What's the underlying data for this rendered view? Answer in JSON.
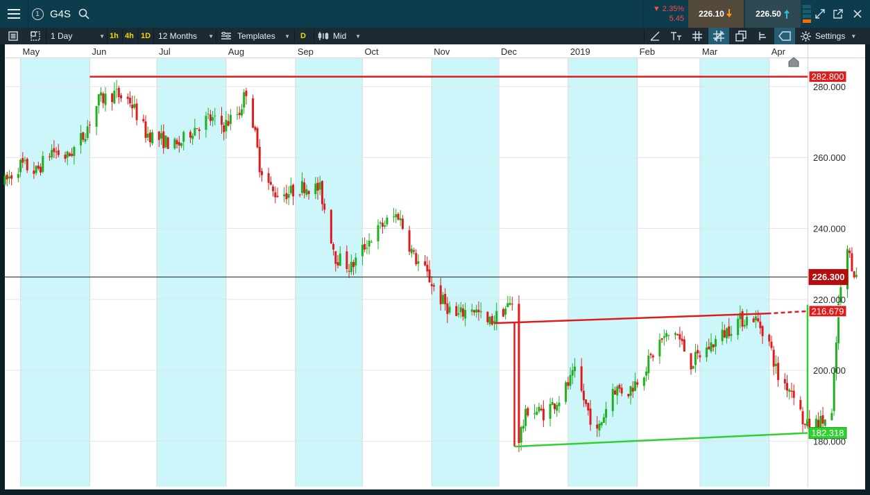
{
  "header": {
    "symbol": "G4S",
    "info_badge": "1",
    "change_pct": "▼ 2.35%",
    "change_abs": "5.45",
    "sell_price": "226.10",
    "buy_price": "226.50",
    "icons": [
      "menu-icon",
      "info-icon",
      "search-icon",
      "level-bars-icon",
      "expand-icon",
      "external-link-icon",
      "close-icon"
    ]
  },
  "toolbar": {
    "interval": "1 Day",
    "quick_intervals": [
      "1h",
      "4h",
      "1D"
    ],
    "range": "12 Months",
    "templates": "Templates",
    "d_badge": "D",
    "price_mode": "Mid",
    "settings": "Settings",
    "icons": [
      "list-icon",
      "layout-icon",
      "template-icon",
      "candles-icon",
      "draw-line-icon",
      "text-tool-icon",
      "grid-icon",
      "crosshair-icon",
      "copy-icon",
      "measure-icon",
      "tag-icon",
      "settings-gear-icon"
    ]
  },
  "colors": {
    "up": "#1fb01f",
    "down": "#e01b1b",
    "shade": "#cdf6fb",
    "resistance": "#e01b1b",
    "support": "#30d030",
    "last_price_bg": "#b40d0d"
  },
  "chart_data": {
    "type": "candlestick",
    "x_axis_labels": [
      "May",
      "Jun",
      "Jul",
      "Aug",
      "Sep",
      "Oct",
      "Nov",
      "Dec",
      "2019",
      "Feb",
      "Mar",
      "Apr"
    ],
    "x_axis_dates": [
      "2018-05-01",
      "2018-06-01",
      "2018-07-01",
      "2018-08-01",
      "2018-09-01",
      "2018-10-01",
      "2018-11-01",
      "2018-12-01",
      "2019-01-01",
      "2019-02-01",
      "2019-03-01",
      "2019-04-01"
    ],
    "y_tick_labels": [
      "180.000",
      "200.000",
      "220.000",
      "240.000",
      "260.000",
      "280.000"
    ],
    "ylim": [
      168.5,
      288.0
    ],
    "xlim": [
      "2018-04-24",
      "2019-04-23"
    ],
    "last_price": 226.3,
    "last_price_label": "226.300",
    "shaded_months": [
      "May",
      "Jul",
      "Sep",
      "Nov",
      "2019",
      "Mar"
    ],
    "price_path": [
      [
        "2018-04-24",
        253
      ],
      [
        "2018-05-01",
        258
      ],
      [
        "2018-05-08",
        256
      ],
      [
        "2018-05-15",
        262
      ],
      [
        "2018-05-22",
        260
      ],
      [
        "2018-05-29",
        266
      ],
      [
        "2018-06-05",
        276
      ],
      [
        "2018-06-12",
        278
      ],
      [
        "2018-06-19",
        276
      ],
      [
        "2018-06-26",
        267
      ],
      [
        "2018-07-03",
        265
      ],
      [
        "2018-07-10",
        263
      ],
      [
        "2018-07-17",
        268
      ],
      [
        "2018-07-24",
        271
      ],
      [
        "2018-07-31",
        269
      ],
      [
        "2018-08-07",
        273
      ],
      [
        "2018-08-10",
        279
      ],
      [
        "2018-08-13",
        270
      ],
      [
        "2018-08-16",
        258
      ],
      [
        "2018-08-22",
        250
      ],
      [
        "2018-08-29",
        250
      ],
      [
        "2018-09-05",
        252
      ],
      [
        "2018-09-12",
        251
      ],
      [
        "2018-09-19",
        232
      ],
      [
        "2018-09-26",
        229
      ],
      [
        "2018-10-03",
        236
      ],
      [
        "2018-10-10",
        241
      ],
      [
        "2018-10-17",
        244
      ],
      [
        "2018-10-24",
        232
      ],
      [
        "2018-10-29",
        228
      ],
      [
        "2018-11-05",
        220
      ],
      [
        "2018-11-12",
        215
      ],
      [
        "2018-11-19",
        218
      ],
      [
        "2018-11-26",
        213
      ],
      [
        "2018-12-03",
        217
      ],
      [
        "2018-12-07",
        219
      ],
      [
        "2018-12-09",
        179
      ],
      [
        "2018-12-14",
        189
      ],
      [
        "2018-12-21",
        188
      ],
      [
        "2018-12-28",
        192
      ],
      [
        "2019-01-04",
        199
      ],
      [
        "2019-01-09",
        190
      ],
      [
        "2019-01-14",
        182
      ],
      [
        "2019-01-21",
        195
      ],
      [
        "2019-01-28",
        194
      ],
      [
        "2019-02-04",
        200
      ],
      [
        "2019-02-11",
        208
      ],
      [
        "2019-02-18",
        211
      ],
      [
        "2019-02-25",
        202
      ],
      [
        "2019-03-04",
        206
      ],
      [
        "2019-03-11",
        210
      ],
      [
        "2019-03-18",
        214
      ],
      [
        "2019-03-25",
        215
      ],
      [
        "2019-03-31",
        210
      ],
      [
        "2019-04-05",
        198
      ],
      [
        "2019-04-12",
        194
      ],
      [
        "2019-04-17",
        184
      ],
      [
        "2019-04-23",
        185
      ],
      [
        "2019-04-29",
        187
      ],
      [
        "2019-05-02",
        218
      ],
      [
        "2019-05-06",
        234
      ],
      [
        "2019-05-10",
        226
      ]
    ],
    "trend_lines": [
      {
        "name": "resistance",
        "color": "red",
        "style": "solid",
        "start": [
          "2018-06-01",
          282.8
        ],
        "end": [
          "2019-05-31",
          282.8
        ],
        "label": "282.800"
      },
      {
        "name": "channel-top",
        "color": "red",
        "style": "solid",
        "start": [
          "2018-11-29",
          213.3
        ],
        "end": [
          "2019-03-31",
          216.0
        ]
      },
      {
        "name": "channel-top-extension",
        "color": "red",
        "style": "dashed",
        "start": [
          "2019-03-31",
          216.0
        ],
        "end": [
          "2019-05-31",
          216.679
        ],
        "label": "216.679"
      },
      {
        "name": "drop-connector",
        "color": "red",
        "style": "solid",
        "start": [
          "2018-12-08",
          213.3
        ],
        "end": [
          "2018-12-08",
          178.5
        ]
      },
      {
        "name": "support",
        "color": "green",
        "style": "solid",
        "start": [
          "2018-12-08",
          178.5
        ],
        "end": [
          "2019-05-31",
          182.318
        ],
        "label": "182.318"
      },
      {
        "name": "breakout",
        "color": "green",
        "style": "solid",
        "start": [
          "2019-05-01",
          185.5
        ],
        "end": [
          "2019-05-02",
          218.5
        ]
      }
    ]
  }
}
